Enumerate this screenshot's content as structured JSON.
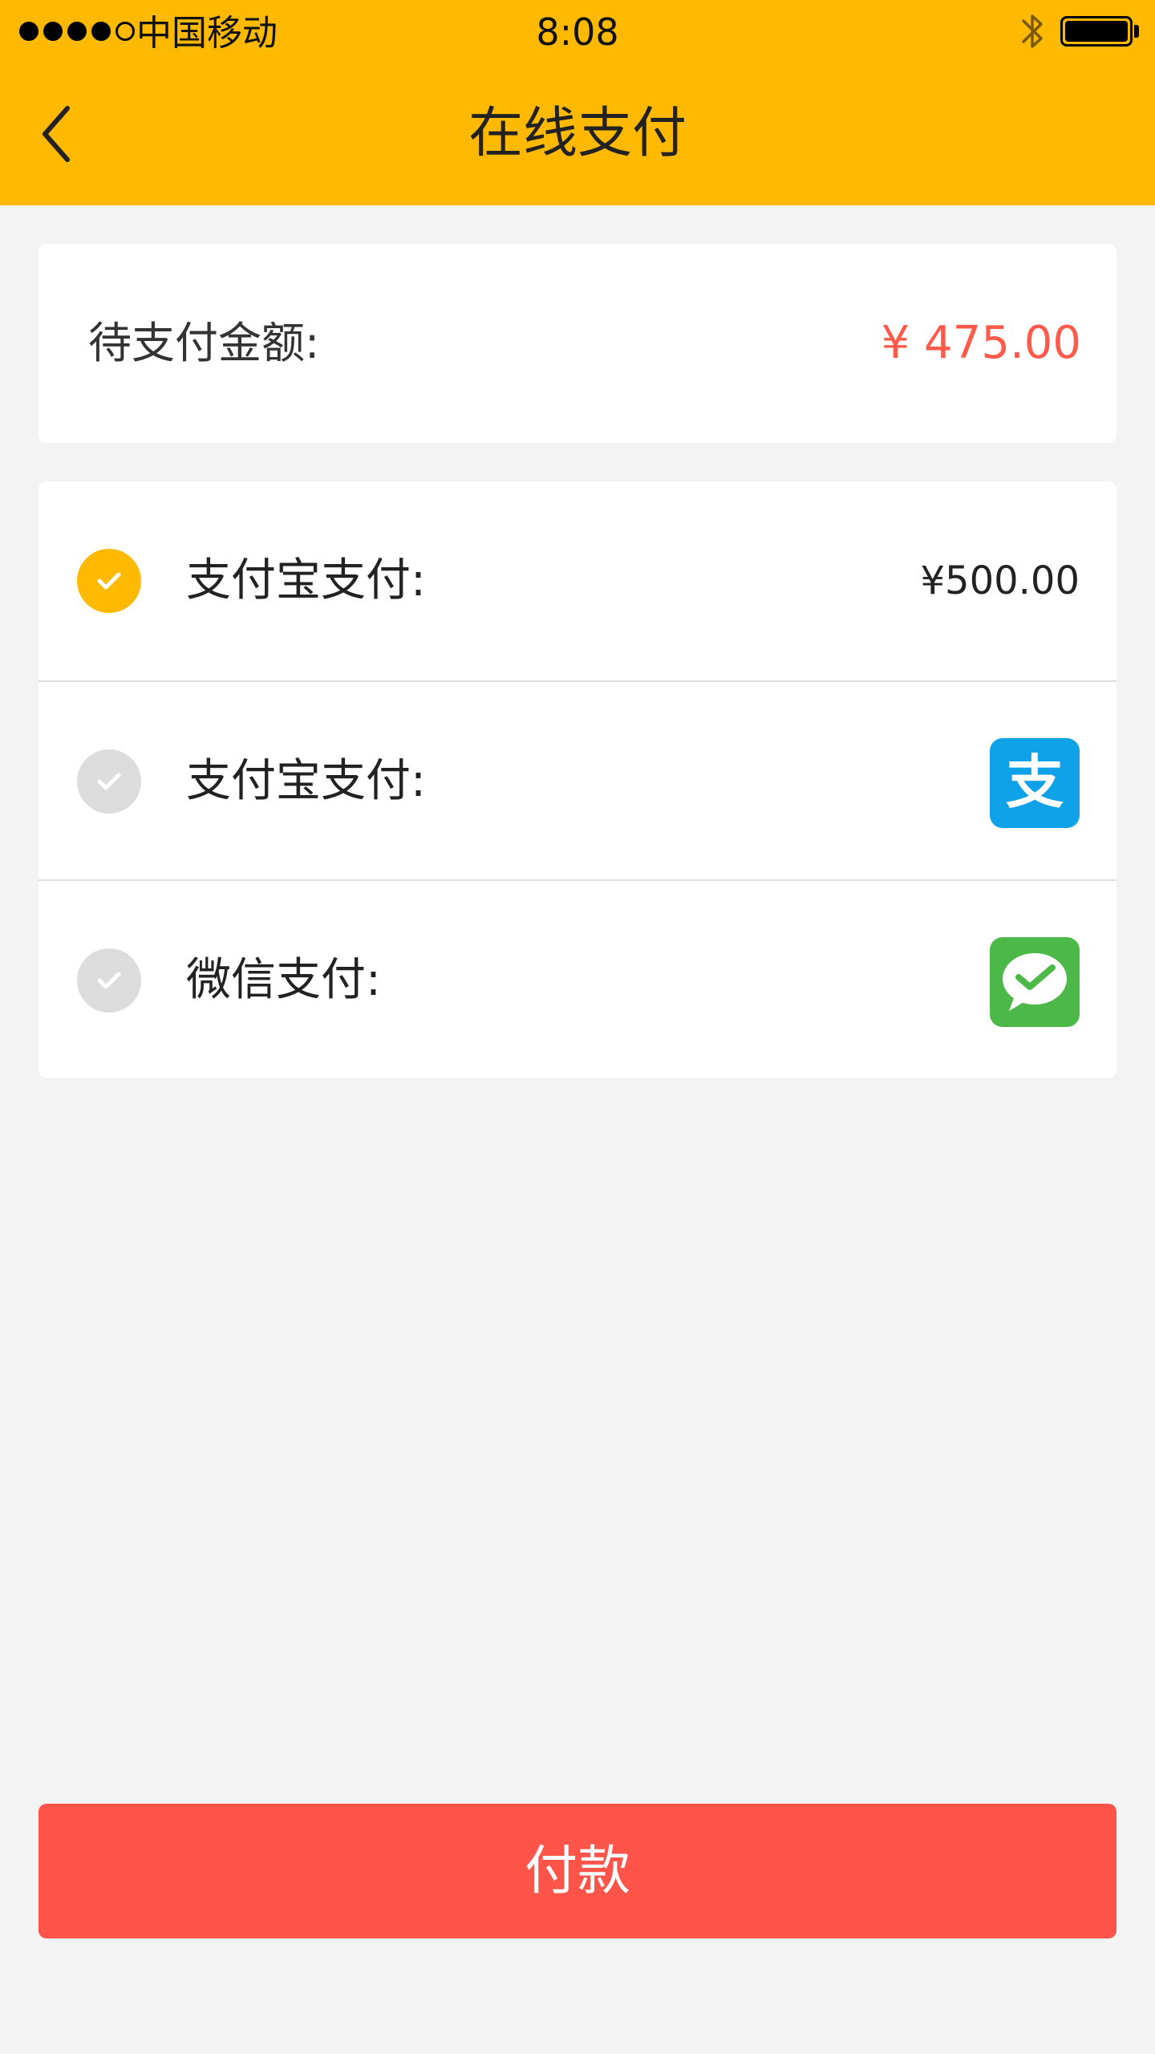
{
  "status_bar": {
    "carrier": "中国移动",
    "time": "8:08",
    "signal_bars_filled": 4,
    "signal_bars_total": 5,
    "battery_level": 1.0,
    "bluetooth_icon": "bluetooth-icon"
  },
  "header": {
    "title": "在线支付",
    "back_icon": "chevron-left-icon",
    "background_color": "#ffb900"
  },
  "amount_due": {
    "label": "待支付金额:",
    "value": "¥ 475.00",
    "value_color": "#ff5a4a"
  },
  "payment_methods": [
    {
      "label": "支付宝支付:",
      "amount": "¥500.00",
      "selected": true,
      "icon": "check-icon"
    },
    {
      "label": "支付宝支付:",
      "selected": false,
      "logo": "alipay-logo-icon",
      "logo_glyph": "支",
      "logo_color": "#10a2e8"
    },
    {
      "label": "微信支付:",
      "selected": false,
      "logo": "wechat-pay-logo-icon",
      "logo_color": "#4cb848"
    }
  ],
  "pay_button": {
    "label": "付款",
    "color": "#ff544a"
  }
}
